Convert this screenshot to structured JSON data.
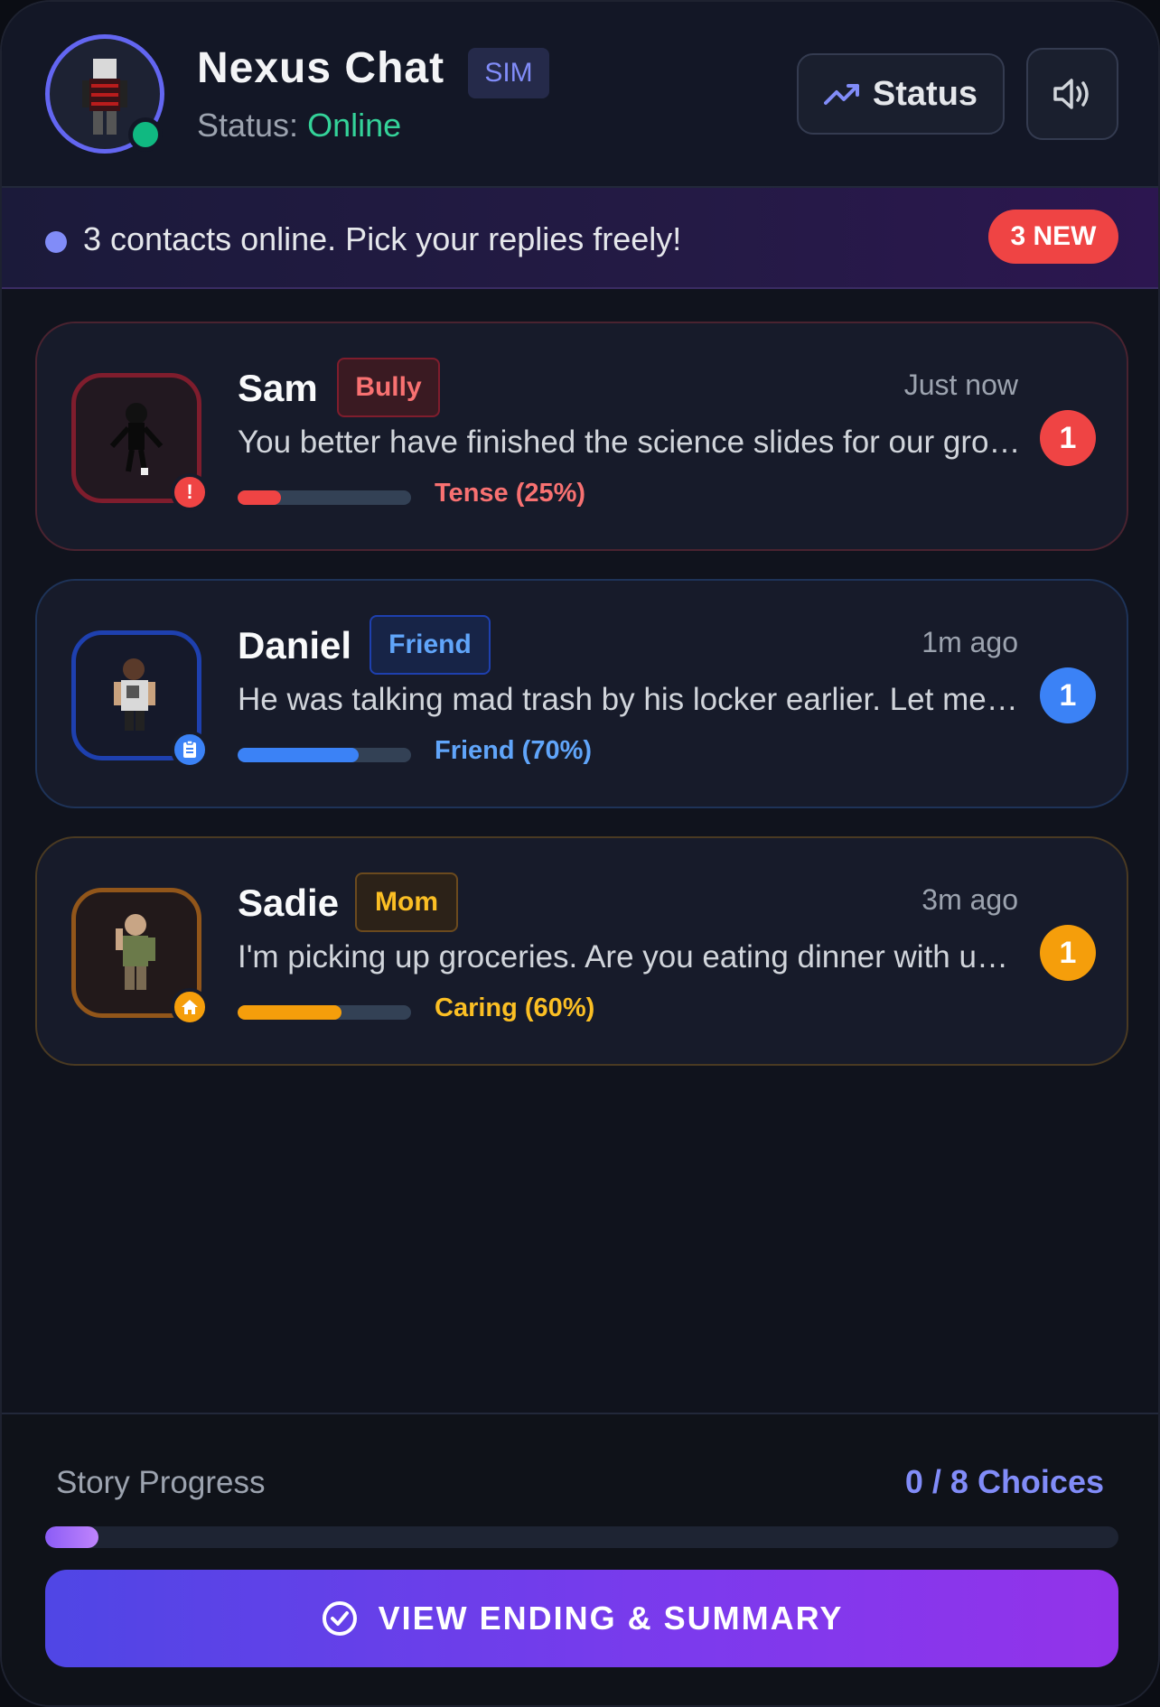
{
  "header": {
    "title": "Nexus Chat",
    "badge": "SIM",
    "status_label": "Status: ",
    "status_value": "Online",
    "status_button": "Status",
    "status_button_icon": "trending-up-icon",
    "sound_icon": "volume-icon"
  },
  "banner": {
    "text": "3 contacts online. Pick your replies freely!",
    "new_badge": "3 NEW"
  },
  "contacts": [
    {
      "name": "Sam",
      "role": "Bully",
      "time": "Just now",
      "message": "You better have finished the science slides for our group project or else.",
      "mood_label": "Tense (25%)",
      "mood_percent": 25,
      "unread": "1",
      "icon": "alert-icon",
      "icon_glyph": "!",
      "color": "#ef4444"
    },
    {
      "name": "Daniel",
      "role": "Friend",
      "time": "1m ago",
      "message": "He was talking mad trash by his locker earlier. Let me know if you need backup.",
      "mood_label": "Friend (70%)",
      "mood_percent": 70,
      "unread": "1",
      "icon": "clipboard-icon",
      "color": "#3b82f6"
    },
    {
      "name": "Sadie",
      "role": "Mom",
      "time": "3m ago",
      "message": "I'm picking up groceries. Are you eating dinner with us tonight?",
      "mood_label": "Caring (60%)",
      "mood_percent": 60,
      "unread": "1",
      "icon": "home-icon",
      "color": "#f59e0b"
    }
  ],
  "footer": {
    "progress_label": "Story Progress",
    "progress_count": "0 / 8 Choices",
    "progress_fraction": 0.05,
    "ending_button": "VIEW ENDING & SUMMARY",
    "ending_icon": "check-circle-icon"
  },
  "colors": {
    "accent": "#6366f1",
    "online": "#34d399",
    "danger": "#ef4444",
    "friend": "#3b82f6",
    "caring": "#f59e0b"
  }
}
